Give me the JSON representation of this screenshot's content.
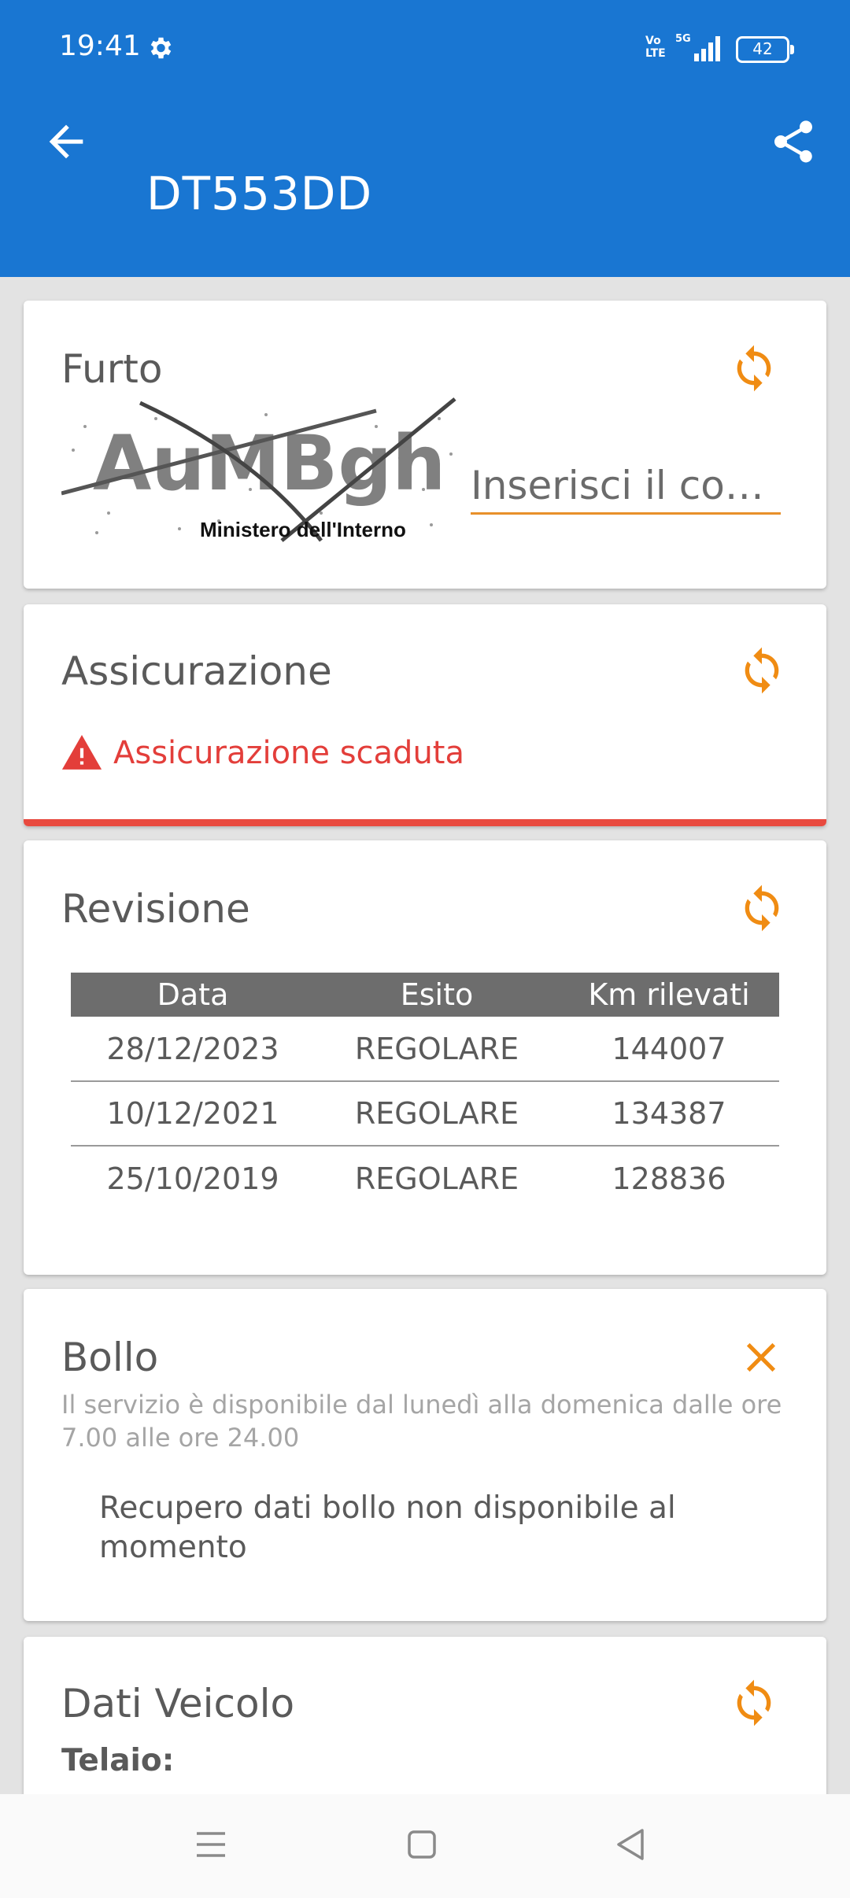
{
  "status_bar": {
    "time": "19:41",
    "volte_line1": "Vo",
    "volte_line2": "LTE",
    "network": "5G",
    "battery": "42"
  },
  "app_bar": {
    "title": "DT553DD",
    "color": "#1976d2"
  },
  "furto": {
    "title": "Furto",
    "captcha_text": "AuMBgh",
    "captcha_caption": "Ministero dell'Interno",
    "code_placeholder": "Inserisci il codi..."
  },
  "assicurazione": {
    "title": "Assicurazione",
    "status_text": "Assicurazione scaduta",
    "status_color": "#e33e3a"
  },
  "revisione": {
    "title": "Revisione",
    "headers": [
      "Data",
      "Esito",
      "Km rilevati"
    ],
    "rows": [
      [
        "28/12/2023",
        "REGOLARE",
        "144007"
      ],
      [
        "10/12/2021",
        "REGOLARE",
        "134387"
      ],
      [
        "25/10/2019",
        "REGOLARE",
        "128836"
      ]
    ]
  },
  "bollo": {
    "title": "Bollo",
    "description": "Il servizio è disponibile dal lunedì alla domenica dalle ore 7.00 alle ore 24.00",
    "message": "Recupero dati bollo non disponibile al momento"
  },
  "dati_veicolo": {
    "title": "Dati Veicolo",
    "telaio_label": "Telaio:"
  },
  "icons": {
    "accent": "#f08c13",
    "back": "arrow-back-icon",
    "share": "share-icon",
    "refresh": "refresh-icon",
    "close": "close-icon",
    "warning": "warning-icon"
  }
}
